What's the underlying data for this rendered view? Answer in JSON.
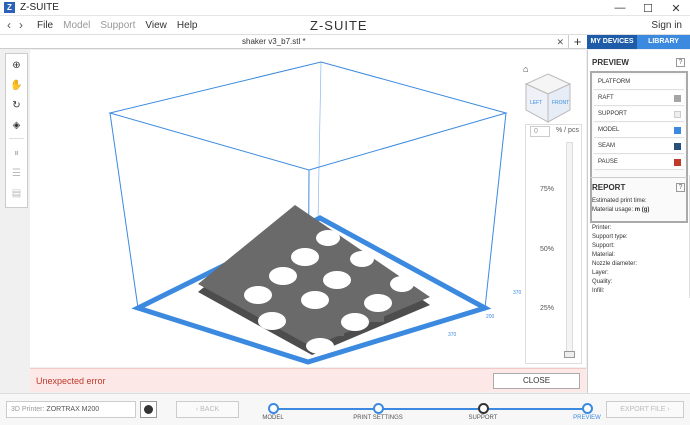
{
  "window": {
    "icon_letter": "Z",
    "title": "Z-SUITE",
    "minimize": "—",
    "maximize": "☐",
    "close": "✕"
  },
  "menu": {
    "back": "‹",
    "forward": "›",
    "items": [
      "File",
      "Model",
      "Support",
      "View",
      "Help"
    ],
    "brand": "Z-SUITE",
    "signin": "Sign in"
  },
  "tabs": {
    "file_tab": "shaker v3_b7.stl *",
    "tab_close": "✕",
    "add": "+",
    "my_devices": "MY DEVICES",
    "library": "LIBRARY"
  },
  "toolbar": {
    "tools": [
      "zoom-icon",
      "pan-icon",
      "rotate-icon",
      "view-icon",
      "pause-icon",
      "layers-icon",
      "grid-icon"
    ]
  },
  "viewport": {
    "home_icon": "⌂",
    "cube_left": "LEFT",
    "cube_front": "FRONT",
    "axis_left_a": "370",
    "axis_left_b": "200",
    "axis_right": "370"
  },
  "layer_slider": {
    "value": "0",
    "unit": "% / pcs",
    "ticks": [
      "75%",
      "50%",
      "25%"
    ]
  },
  "error": {
    "message": "Unexpected error",
    "close_label": "CLOSE"
  },
  "preview": {
    "heading": "PREVIEW",
    "help": "?",
    "items": [
      {
        "label": "PLATFORM",
        "color": ""
      },
      {
        "label": "RAFT",
        "color": "#a5a5a5"
      },
      {
        "label": "SUPPORT",
        "color": "#eeeeee"
      },
      {
        "label": "MODEL",
        "color": "#3c8ae0"
      },
      {
        "label": "SEAM",
        "color": "#284e7a"
      },
      {
        "label": "PAUSE",
        "color": "#c0392b"
      }
    ]
  },
  "report": {
    "heading": "REPORT",
    "help": "?",
    "print_time_label": "Estimated print time:",
    "material_usage_label": "Material usage:",
    "material_usage_value": "m (g)",
    "printer_label": "Printer:",
    "support_type_label": "Support type:",
    "support_label": "Support:",
    "material_label": "Material:",
    "nozzle_label": "Nozzle diameter:",
    "layer_label": "Layer:",
    "quality_label": "Quality:",
    "infill_label": "Infill:"
  },
  "bottom": {
    "printer_prefix": "3D Printer:",
    "printer_value": "ZORTRAX M200",
    "back_label": "‹ BACK",
    "export_label": "EXPORT FILE ›",
    "steps": [
      "MODEL",
      "PRINT SETTINGS",
      "SUPPORT",
      "PREVIEW"
    ],
    "active_step": "PREVIEW"
  },
  "colors": {
    "accent": "#3c8ae0",
    "accent_dark": "#1e5ba8",
    "model_gray": "#5a5a5a",
    "error_red": "#c0392b"
  }
}
